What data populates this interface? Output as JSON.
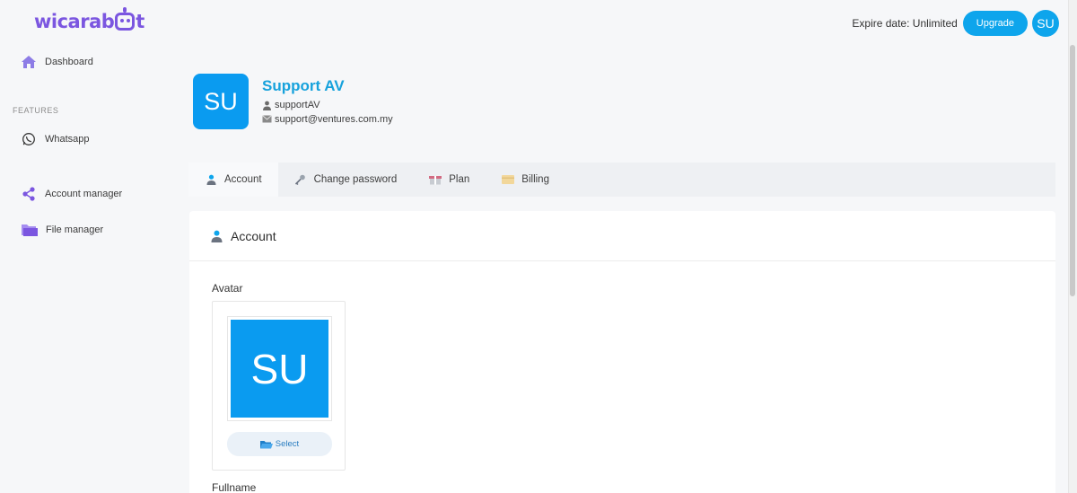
{
  "brand": {
    "logo_left": "wicarab",
    "logo_right": "t"
  },
  "topbar": {
    "expire_text": "Expire date: Unlimited",
    "upgrade_label": "Upgrade",
    "avatar_initials": "SU"
  },
  "sidebar": {
    "dashboard": "Dashboard",
    "section": "FEATURES",
    "whatsapp": "Whatsapp",
    "account_manager": "Account manager",
    "file_manager": "File manager"
  },
  "profile": {
    "initials": "SU",
    "name": "Support AV",
    "username": "supportAV",
    "email": "support@ventures.com.my"
  },
  "tabs": [
    {
      "label": "Account",
      "icon": "user-icon"
    },
    {
      "label": "Change password",
      "icon": "key-icon"
    },
    {
      "label": "Plan",
      "icon": "package-icon"
    },
    {
      "label": "Billing",
      "icon": "credit-card-icon"
    }
  ],
  "card": {
    "title": "Account",
    "avatar_label": "Avatar",
    "avatar_initials": "SU",
    "select_label": "Select",
    "fullname_label": "Fullname"
  },
  "colors": {
    "accent": "#0ea5ec",
    "brand": "#7b56e0",
    "name": "#17a2dc"
  }
}
